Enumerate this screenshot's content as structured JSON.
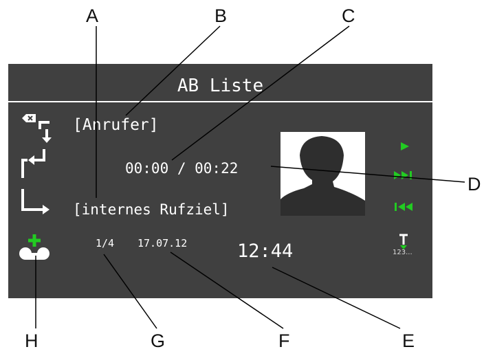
{
  "screen": {
    "title": "AB Liste",
    "caller": "[Anrufer]",
    "playback_time": "00:00 / 00:22",
    "internal_target": "[internes Rufziel]",
    "message_index": "1/4",
    "date": "17.07.12",
    "time": "12:44",
    "text_mode_label": "123..."
  },
  "callouts": {
    "a": "A",
    "b": "B",
    "c": "C",
    "d": "D",
    "e": "E",
    "f": "F",
    "g": "G",
    "h": "H"
  },
  "icons": {
    "delete": "delete-icon",
    "reply": "reply-arrow-icon",
    "forward": "forward-arrow-icon",
    "play": "play-icon",
    "next": "skip-next-icon",
    "previous": "skip-previous-icon",
    "text_mode": "text-input-icon",
    "add_voicemail": "add-voicemail-icon",
    "avatar": "contact-photo-icon"
  },
  "colors": {
    "screen_bg": "#404040",
    "text": "#ffffff",
    "accent_green": "#22cc22",
    "icon_white": "#ffffff"
  }
}
